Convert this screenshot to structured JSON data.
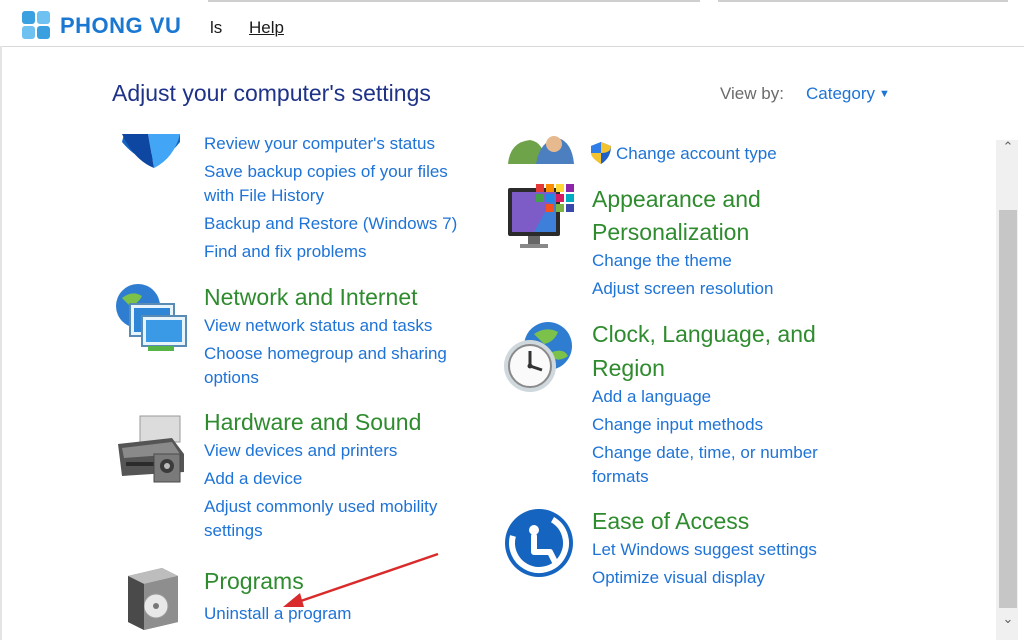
{
  "brand": {
    "logo_text": "PHONG VU"
  },
  "menu": {
    "tools_fragment": "ls",
    "help_label": "Help"
  },
  "page": {
    "title": "Adjust your computer's settings",
    "view_by_label": "View by:",
    "view_by_value": "Category"
  },
  "left_column": {
    "system_security": {
      "links": [
        "Review your computer's status",
        "Save backup copies of your files",
        "with File History",
        "Backup and Restore (Windows 7)",
        "Find and fix problems"
      ]
    },
    "network": {
      "title": "Network and Internet",
      "links": [
        "View network status and tasks",
        "Choose homegroup and sharing",
        "options"
      ]
    },
    "hardware": {
      "title": "Hardware and Sound",
      "links": [
        "View devices and printers",
        "Add a device",
        "Adjust commonly used mobility",
        "settings"
      ]
    },
    "programs": {
      "title": "Programs",
      "links": [
        "Uninstall a program"
      ]
    }
  },
  "right_column": {
    "user_accounts": {
      "links": [
        "Change account type"
      ]
    },
    "appearance": {
      "title_lines": [
        "Appearance and",
        "Personalization"
      ],
      "links": [
        "Change the theme",
        "Adjust screen resolution"
      ]
    },
    "clock": {
      "title_lines": [
        "Clock, Language, and",
        "Region"
      ],
      "links": [
        "Add a language",
        "Change input methods",
        "Change date, time, or number",
        "formats"
      ]
    },
    "ease": {
      "title": "Ease of Access",
      "links": [
        "Let Windows suggest settings",
        "Optimize visual display"
      ]
    }
  },
  "colors": {
    "title": "#1e3287",
    "link": "#1e73d6",
    "category": "#2e8b2e",
    "annotation_arrow": "#d92b2b",
    "brand": "#1a78d2"
  },
  "icons": [
    "shield-icon",
    "users-icon",
    "uac-shield-icon",
    "monitor-palette-icon",
    "network-globe-icon",
    "clock-globe-icon",
    "printer-icon",
    "ease-of-access-icon",
    "programs-box-icon",
    "dropdown-caret-icon"
  ]
}
